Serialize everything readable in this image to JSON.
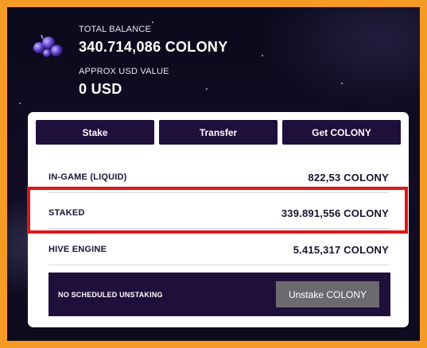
{
  "balance": {
    "total_label": "TOTAL BALANCE",
    "total_value": "340.714,086 COLONY",
    "usd_label": "APPROX USD VALUE",
    "usd_value": "0 USD"
  },
  "actions": {
    "stake_label": "Stake",
    "transfer_label": "Transfer",
    "get_label": "Get COLONY"
  },
  "rows": [
    {
      "name": "IN-GAME (LIQUID)",
      "value": "822,53 COLONY"
    },
    {
      "name": "STAKED",
      "value": "339.891,556 COLONY"
    },
    {
      "name": "HIVE ENGINE",
      "value": "5.415,317 COLONY"
    }
  ],
  "unstake": {
    "message": "NO SCHEDULED UNSTAKING",
    "button_label": "Unstake COLONY"
  },
  "icons": {
    "token": "colony-token-icon"
  },
  "colors": {
    "outer_border": "#f49a25",
    "highlight_border": "#e01616",
    "button_bg": "#1f0f3b",
    "unstake_button_bg": "#6c6a6e"
  }
}
